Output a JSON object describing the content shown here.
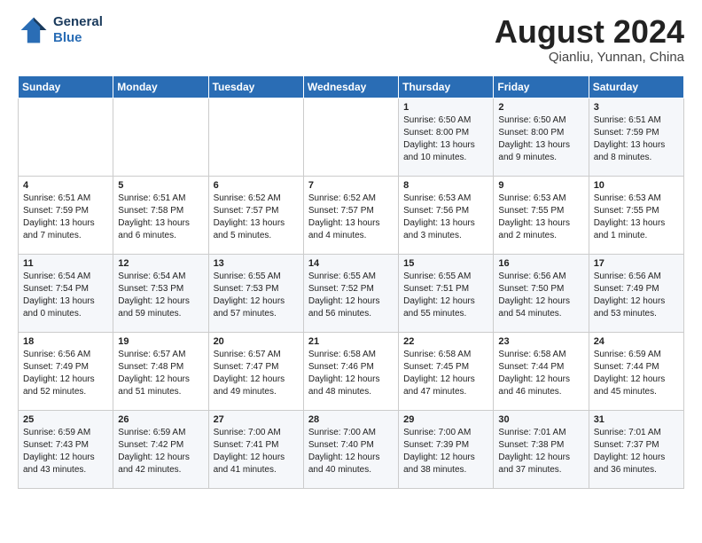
{
  "header": {
    "logo_line1": "General",
    "logo_line2": "Blue",
    "month_title": "August 2024",
    "location": "Qianliu, Yunnan, China"
  },
  "weekdays": [
    "Sunday",
    "Monday",
    "Tuesday",
    "Wednesday",
    "Thursday",
    "Friday",
    "Saturday"
  ],
  "weeks": [
    [
      {
        "day": "",
        "info": ""
      },
      {
        "day": "",
        "info": ""
      },
      {
        "day": "",
        "info": ""
      },
      {
        "day": "",
        "info": ""
      },
      {
        "day": "1",
        "info": "Sunrise: 6:50 AM\nSunset: 8:00 PM\nDaylight: 13 hours\nand 10 minutes."
      },
      {
        "day": "2",
        "info": "Sunrise: 6:50 AM\nSunset: 8:00 PM\nDaylight: 13 hours\nand 9 minutes."
      },
      {
        "day": "3",
        "info": "Sunrise: 6:51 AM\nSunset: 7:59 PM\nDaylight: 13 hours\nand 8 minutes."
      }
    ],
    [
      {
        "day": "4",
        "info": "Sunrise: 6:51 AM\nSunset: 7:59 PM\nDaylight: 13 hours\nand 7 minutes."
      },
      {
        "day": "5",
        "info": "Sunrise: 6:51 AM\nSunset: 7:58 PM\nDaylight: 13 hours\nand 6 minutes."
      },
      {
        "day": "6",
        "info": "Sunrise: 6:52 AM\nSunset: 7:57 PM\nDaylight: 13 hours\nand 5 minutes."
      },
      {
        "day": "7",
        "info": "Sunrise: 6:52 AM\nSunset: 7:57 PM\nDaylight: 13 hours\nand 4 minutes."
      },
      {
        "day": "8",
        "info": "Sunrise: 6:53 AM\nSunset: 7:56 PM\nDaylight: 13 hours\nand 3 minutes."
      },
      {
        "day": "9",
        "info": "Sunrise: 6:53 AM\nSunset: 7:55 PM\nDaylight: 13 hours\nand 2 minutes."
      },
      {
        "day": "10",
        "info": "Sunrise: 6:53 AM\nSunset: 7:55 PM\nDaylight: 13 hours\nand 1 minute."
      }
    ],
    [
      {
        "day": "11",
        "info": "Sunrise: 6:54 AM\nSunset: 7:54 PM\nDaylight: 13 hours\nand 0 minutes."
      },
      {
        "day": "12",
        "info": "Sunrise: 6:54 AM\nSunset: 7:53 PM\nDaylight: 12 hours\nand 59 minutes."
      },
      {
        "day": "13",
        "info": "Sunrise: 6:55 AM\nSunset: 7:53 PM\nDaylight: 12 hours\nand 57 minutes."
      },
      {
        "day": "14",
        "info": "Sunrise: 6:55 AM\nSunset: 7:52 PM\nDaylight: 12 hours\nand 56 minutes."
      },
      {
        "day": "15",
        "info": "Sunrise: 6:55 AM\nSunset: 7:51 PM\nDaylight: 12 hours\nand 55 minutes."
      },
      {
        "day": "16",
        "info": "Sunrise: 6:56 AM\nSunset: 7:50 PM\nDaylight: 12 hours\nand 54 minutes."
      },
      {
        "day": "17",
        "info": "Sunrise: 6:56 AM\nSunset: 7:49 PM\nDaylight: 12 hours\nand 53 minutes."
      }
    ],
    [
      {
        "day": "18",
        "info": "Sunrise: 6:56 AM\nSunset: 7:49 PM\nDaylight: 12 hours\nand 52 minutes."
      },
      {
        "day": "19",
        "info": "Sunrise: 6:57 AM\nSunset: 7:48 PM\nDaylight: 12 hours\nand 51 minutes."
      },
      {
        "day": "20",
        "info": "Sunrise: 6:57 AM\nSunset: 7:47 PM\nDaylight: 12 hours\nand 49 minutes."
      },
      {
        "day": "21",
        "info": "Sunrise: 6:58 AM\nSunset: 7:46 PM\nDaylight: 12 hours\nand 48 minutes."
      },
      {
        "day": "22",
        "info": "Sunrise: 6:58 AM\nSunset: 7:45 PM\nDaylight: 12 hours\nand 47 minutes."
      },
      {
        "day": "23",
        "info": "Sunrise: 6:58 AM\nSunset: 7:44 PM\nDaylight: 12 hours\nand 46 minutes."
      },
      {
        "day": "24",
        "info": "Sunrise: 6:59 AM\nSunset: 7:44 PM\nDaylight: 12 hours\nand 45 minutes."
      }
    ],
    [
      {
        "day": "25",
        "info": "Sunrise: 6:59 AM\nSunset: 7:43 PM\nDaylight: 12 hours\nand 43 minutes."
      },
      {
        "day": "26",
        "info": "Sunrise: 6:59 AM\nSunset: 7:42 PM\nDaylight: 12 hours\nand 42 minutes."
      },
      {
        "day": "27",
        "info": "Sunrise: 7:00 AM\nSunset: 7:41 PM\nDaylight: 12 hours\nand 41 minutes."
      },
      {
        "day": "28",
        "info": "Sunrise: 7:00 AM\nSunset: 7:40 PM\nDaylight: 12 hours\nand 40 minutes."
      },
      {
        "day": "29",
        "info": "Sunrise: 7:00 AM\nSunset: 7:39 PM\nDaylight: 12 hours\nand 38 minutes."
      },
      {
        "day": "30",
        "info": "Sunrise: 7:01 AM\nSunset: 7:38 PM\nDaylight: 12 hours\nand 37 minutes."
      },
      {
        "day": "31",
        "info": "Sunrise: 7:01 AM\nSunset: 7:37 PM\nDaylight: 12 hours\nand 36 minutes."
      }
    ]
  ]
}
